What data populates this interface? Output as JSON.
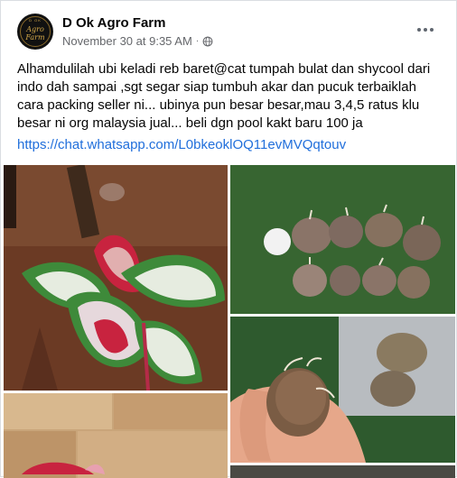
{
  "post": {
    "page_name": "D Ok Agro Farm",
    "timestamp": "November 30 at 9:35 AM",
    "separator": "·",
    "avatar_text": "Agro Farm",
    "avatar_top": "D OK",
    "body": "Alhamdulilah ubi keladi reb baret@cat tumpah bulat dan shycool dari indo dah sampai ,sgt segar siap tumbuh akar dan pucuk terbaiklah cara packing seller ni... ubinya pun besar besar,mau 3,4,5 ratus klu besar ni org malaysia jual... beli dgn pool kakt baru 100 ja",
    "link": "https://chat.whatsapp.com/L0bkeoklOQ11evMVQqtouv"
  },
  "icons": {
    "privacy": "globe-icon",
    "menu": "more-horizontal-icon"
  },
  "colors": {
    "link": "#216fdb",
    "secondary_text": "#65676b",
    "primary_text": "#050505"
  }
}
